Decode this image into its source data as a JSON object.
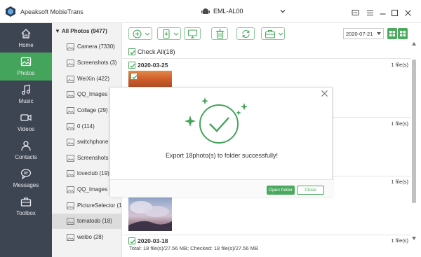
{
  "app": {
    "title": "Apeaksoft MobieTrans"
  },
  "device": {
    "name": "EML-AL00"
  },
  "nav": [
    {
      "label": "Home",
      "icon": "home-icon"
    },
    {
      "label": "Photos",
      "icon": "photos-icon",
      "active": true
    },
    {
      "label": "Music",
      "icon": "music-icon"
    },
    {
      "label": "Videos",
      "icon": "videos-icon"
    },
    {
      "label": "Contacts",
      "icon": "contacts-icon"
    },
    {
      "label": "Messages",
      "icon": "messages-icon"
    },
    {
      "label": "Toolbox",
      "icon": "toolbox-icon"
    }
  ],
  "albums": {
    "header": "All Photos (9477)",
    "items": [
      {
        "label": "Camera (7330)"
      },
      {
        "label": "Screenshots (3)"
      },
      {
        "label": "WeiXin (422)"
      },
      {
        "label": "QQ_Images (5"
      },
      {
        "label": "Collage (29)"
      },
      {
        "label": "0 (114)"
      },
      {
        "label": "switchphone ("
      },
      {
        "label": "Screenshots (1"
      },
      {
        "label": "loveclub (19)"
      },
      {
        "label": "QQ_Images (1"
      },
      {
        "label": "PictureSelector (1"
      },
      {
        "label": "tomatodo (18)",
        "selected": true
      },
      {
        "label": "weibo (28)"
      }
    ]
  },
  "toolbar": {
    "date_filter": "2020-07-21"
  },
  "list": {
    "check_all": "Check All(18)",
    "groups": [
      {
        "date": "2020-03-25",
        "count": "1 file(s)"
      },
      {
        "date": "",
        "count": "1 file(s)"
      },
      {
        "date": "",
        "count": "1 file(s)"
      },
      {
        "date": "",
        "count": "1 file(s)"
      },
      {
        "date": "2020-03-18",
        "count": "1 file(s)"
      }
    ]
  },
  "dialog": {
    "message": "Export 18photo(s) to folder successfully!",
    "open_folder": "Open folder",
    "close": "Close"
  },
  "status": {
    "text": "Total: 18 file(s)/27.56 MB; Checked: 18 file(s)/27.56 MB"
  },
  "colors": {
    "accent": "#45a45c",
    "sidebar": "#3d4452"
  }
}
